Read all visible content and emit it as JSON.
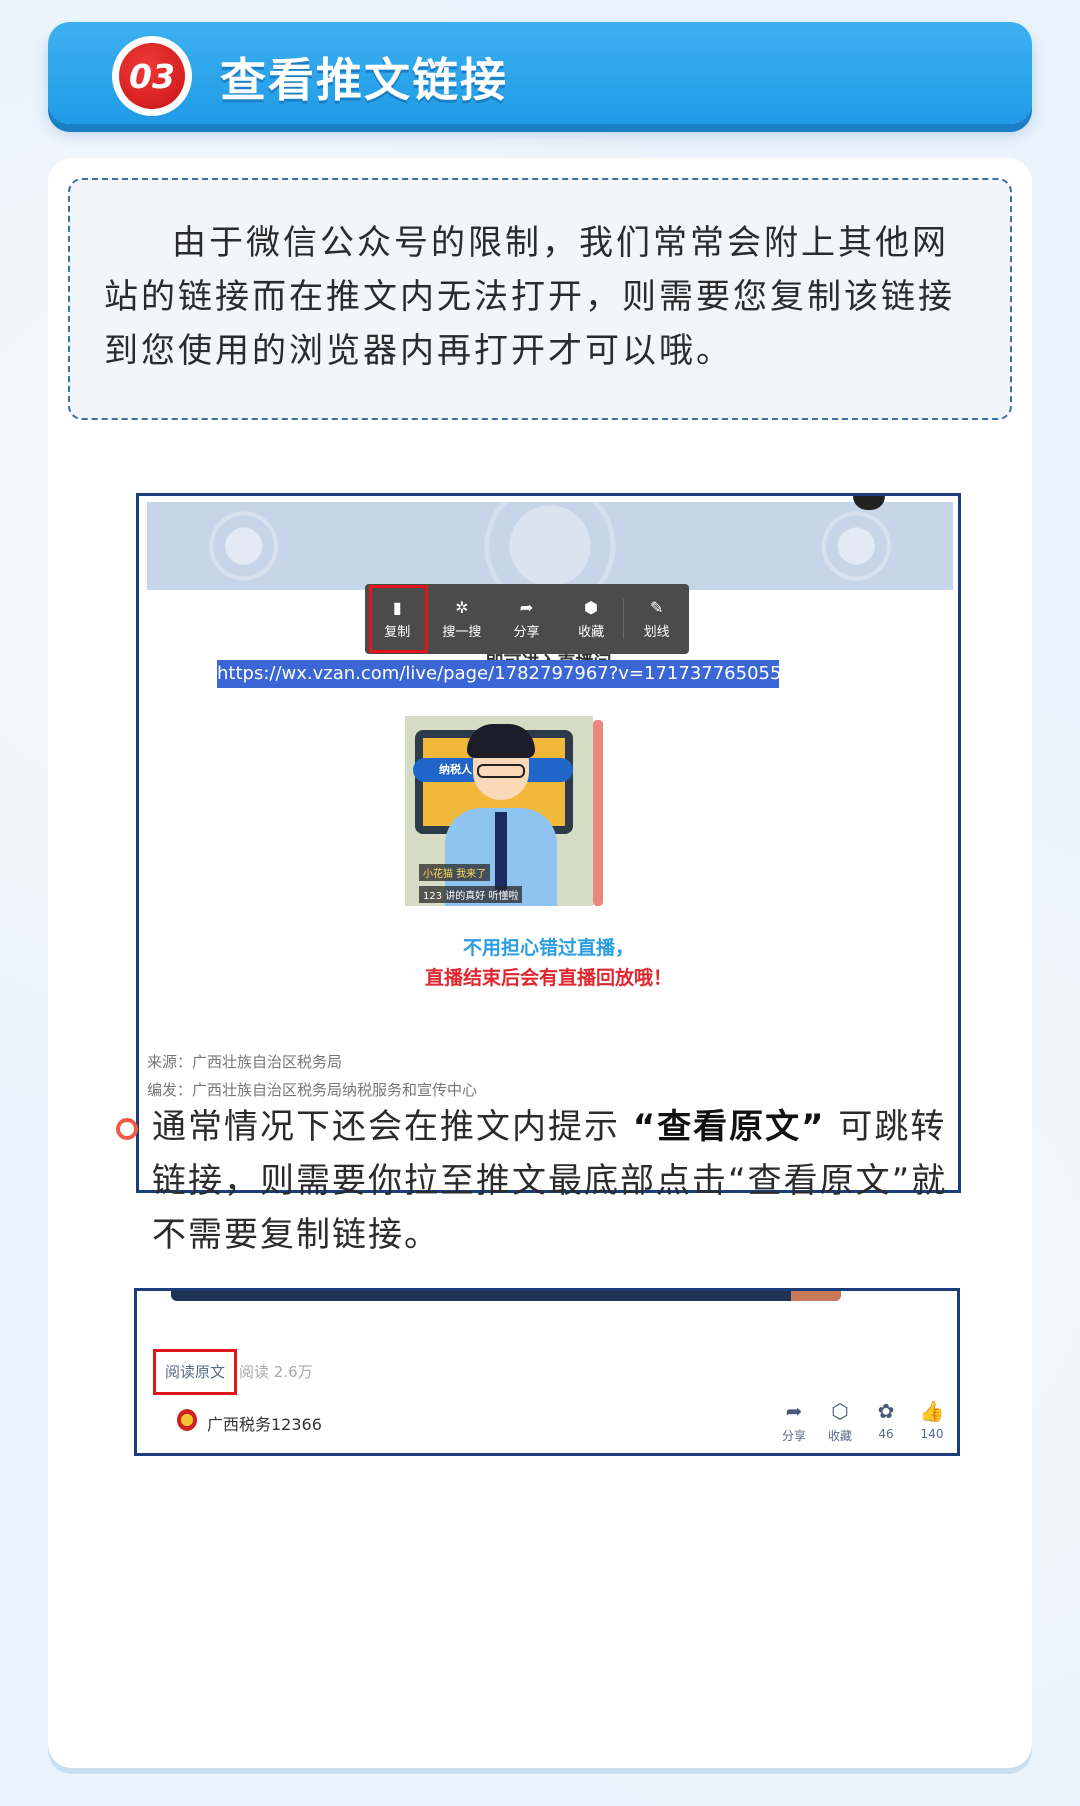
{
  "header": {
    "badge_number": "03",
    "title": "查看推文链接"
  },
  "intro_text": "由于微信公众号的限制，我们常常会附上其他网站的链接而在推文内无法打开，则需要您复制该链接到您使用的浏览器内再打开才可以哦。",
  "screenshot1": {
    "popup_menu": [
      {
        "icon": "copy-icon",
        "glyph": "▮",
        "label": "复制",
        "highlighted": true
      },
      {
        "icon": "search-icon",
        "glyph": "✲",
        "label": "搜一搜",
        "highlighted": false
      },
      {
        "icon": "share-icon",
        "glyph": "➦",
        "label": "分享",
        "highlighted": false
      },
      {
        "icon": "collect-icon",
        "glyph": "⬢",
        "label": "收藏",
        "highlighted": false
      },
      {
        "icon": "underline-icon",
        "glyph": "✎",
        "label": "划线",
        "highlighted": false
      }
    ],
    "enter_live_text": "即可进入直播间",
    "url": "https://wx.vzan.com/live/page/1782797967?v=1717377650551",
    "illustration": {
      "banner_text": "纳税人    直播",
      "comment1": "小花猫  我来了",
      "comment2": "123  讲的真好 听懂啦"
    },
    "note_line1": "不用担心错过直播，",
    "note_line2": "直播结束后会有直播回放哦！",
    "source": "来源：广西壮族自治区税务局",
    "editor": "编发：广西壮族自治区税务局纳税服务和宣传中心"
  },
  "tip": {
    "part1": "通常情况下还会在推文内提示",
    "bold": "“查看原文”",
    "part2": "可跳转链接，则需要你拉至推文最底部点击“查看原文”就不需要复制链接。"
  },
  "screenshot2": {
    "read_original": "阅读原文",
    "read_count": "阅读 2.6万",
    "account_name": "广西税务12366",
    "actions": [
      {
        "icon": "share-icon",
        "glyph": "➦",
        "label": "分享"
      },
      {
        "icon": "collect-icon",
        "glyph": "⬡",
        "label": "收藏"
      },
      {
        "icon": "like-flower-icon",
        "glyph": "✿",
        "label": "46"
      },
      {
        "icon": "thumbs-up-icon",
        "glyph": "👍",
        "label": "140"
      }
    ]
  },
  "colors": {
    "banner_blue": "#1f9be6",
    "badge_red": "#c81414",
    "highlight_red": "#e0161a",
    "url_highlight": "#3b67d6",
    "note_blue": "#2a9ee0",
    "note_red": "#e02730",
    "bullet_orange": "#f15a47"
  }
}
